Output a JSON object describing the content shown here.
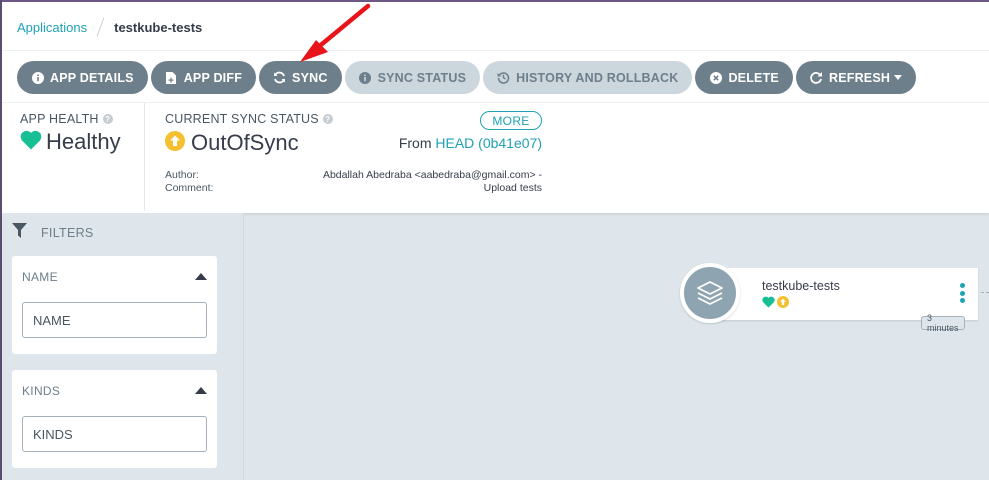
{
  "breadcrumb": {
    "parent": "Applications",
    "current": "testkube-tests"
  },
  "toolbar": {
    "app_details": "APP DETAILS",
    "app_diff": "APP DIFF",
    "sync": "SYNC",
    "sync_status": "SYNC STATUS",
    "history": "HISTORY AND ROLLBACK",
    "delete": "DELETE",
    "refresh": "REFRESH"
  },
  "app_health": {
    "title": "APP HEALTH",
    "value": "Healthy",
    "color": "#18be94"
  },
  "sync_status": {
    "title": "CURRENT SYNC STATUS",
    "value": "OutOfSync",
    "color": "#f4c030",
    "more": "MORE",
    "from_label": "From",
    "revision": "HEAD (0b41e07)",
    "author_label": "Author:",
    "comment_label": "Comment:",
    "author": "Abdallah Abedraba <aabedraba@gmail.com> -",
    "comment": "Upload tests"
  },
  "filters": {
    "title": "FILTERS",
    "name": {
      "title": "NAME",
      "placeholder": "NAME"
    },
    "kinds": {
      "title": "KINDS",
      "placeholder": "KINDS"
    }
  },
  "node": {
    "name": "testkube-tests",
    "age": "3 minutes"
  },
  "colors": {
    "accent": "#1ea2b5",
    "button_dark": "#6d7f8b",
    "button_disabled": "#ccd6dd",
    "annotation_arrow": "#e8141a"
  }
}
